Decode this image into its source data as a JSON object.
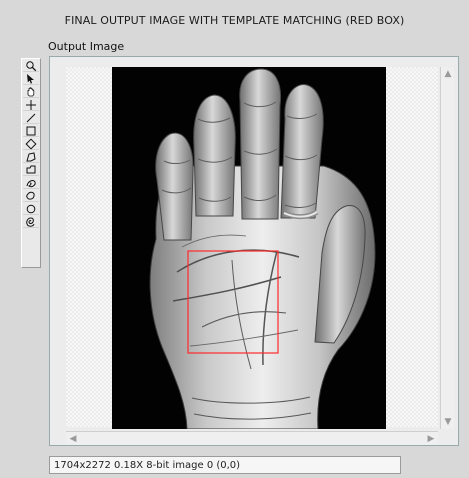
{
  "window": {
    "title": "FINAL OUTPUT IMAGE WITH TEMPLATE MATCHING (RED BOX)"
  },
  "panel": {
    "label": "Output Image"
  },
  "toolbar": {
    "tools": [
      "zoom-icon",
      "pointer-icon",
      "pan-icon",
      "crosshair-icon",
      "line-icon",
      "rectangle-icon",
      "rotated-rectangle-icon",
      "polygon-icon",
      "freehand-icon",
      "annulus-icon",
      "oval-icon",
      "broken-line-icon",
      "spiral-icon"
    ]
  },
  "status": {
    "text": "1704x2272 0.18X 8-bit image 0    (0,0)"
  },
  "colors": {
    "background": "#d8d8d8",
    "image_background": "#020202",
    "highlight_box": "#ff2a2a"
  }
}
